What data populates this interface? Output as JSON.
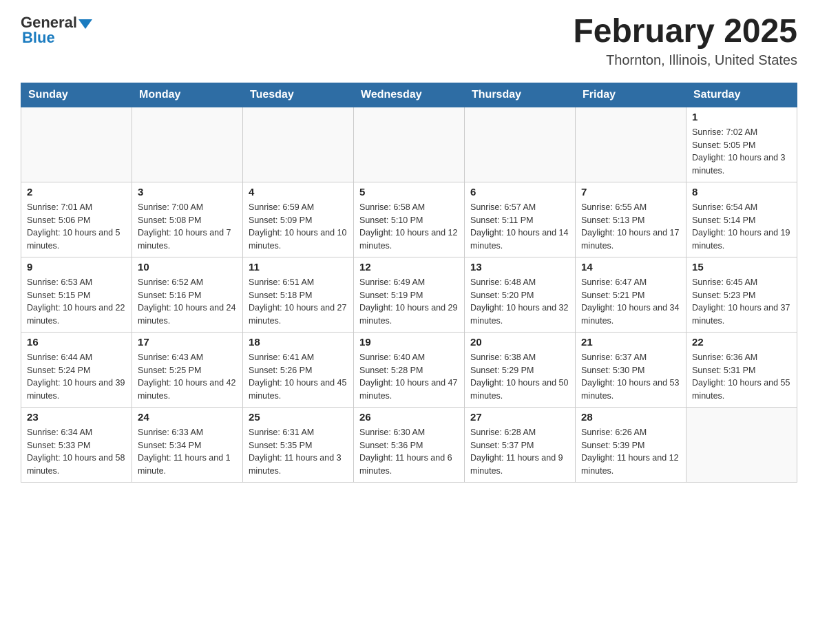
{
  "logo": {
    "general": "General",
    "blue": "Blue"
  },
  "header": {
    "month": "February 2025",
    "location": "Thornton, Illinois, United States"
  },
  "days_of_week": [
    "Sunday",
    "Monday",
    "Tuesday",
    "Wednesday",
    "Thursday",
    "Friday",
    "Saturday"
  ],
  "weeks": [
    [
      {
        "day": "",
        "info": ""
      },
      {
        "day": "",
        "info": ""
      },
      {
        "day": "",
        "info": ""
      },
      {
        "day": "",
        "info": ""
      },
      {
        "day": "",
        "info": ""
      },
      {
        "day": "",
        "info": ""
      },
      {
        "day": "1",
        "info": "Sunrise: 7:02 AM\nSunset: 5:05 PM\nDaylight: 10 hours and 3 minutes."
      }
    ],
    [
      {
        "day": "2",
        "info": "Sunrise: 7:01 AM\nSunset: 5:06 PM\nDaylight: 10 hours and 5 minutes."
      },
      {
        "day": "3",
        "info": "Sunrise: 7:00 AM\nSunset: 5:08 PM\nDaylight: 10 hours and 7 minutes."
      },
      {
        "day": "4",
        "info": "Sunrise: 6:59 AM\nSunset: 5:09 PM\nDaylight: 10 hours and 10 minutes."
      },
      {
        "day": "5",
        "info": "Sunrise: 6:58 AM\nSunset: 5:10 PM\nDaylight: 10 hours and 12 minutes."
      },
      {
        "day": "6",
        "info": "Sunrise: 6:57 AM\nSunset: 5:11 PM\nDaylight: 10 hours and 14 minutes."
      },
      {
        "day": "7",
        "info": "Sunrise: 6:55 AM\nSunset: 5:13 PM\nDaylight: 10 hours and 17 minutes."
      },
      {
        "day": "8",
        "info": "Sunrise: 6:54 AM\nSunset: 5:14 PM\nDaylight: 10 hours and 19 minutes."
      }
    ],
    [
      {
        "day": "9",
        "info": "Sunrise: 6:53 AM\nSunset: 5:15 PM\nDaylight: 10 hours and 22 minutes."
      },
      {
        "day": "10",
        "info": "Sunrise: 6:52 AM\nSunset: 5:16 PM\nDaylight: 10 hours and 24 minutes."
      },
      {
        "day": "11",
        "info": "Sunrise: 6:51 AM\nSunset: 5:18 PM\nDaylight: 10 hours and 27 minutes."
      },
      {
        "day": "12",
        "info": "Sunrise: 6:49 AM\nSunset: 5:19 PM\nDaylight: 10 hours and 29 minutes."
      },
      {
        "day": "13",
        "info": "Sunrise: 6:48 AM\nSunset: 5:20 PM\nDaylight: 10 hours and 32 minutes."
      },
      {
        "day": "14",
        "info": "Sunrise: 6:47 AM\nSunset: 5:21 PM\nDaylight: 10 hours and 34 minutes."
      },
      {
        "day": "15",
        "info": "Sunrise: 6:45 AM\nSunset: 5:23 PM\nDaylight: 10 hours and 37 minutes."
      }
    ],
    [
      {
        "day": "16",
        "info": "Sunrise: 6:44 AM\nSunset: 5:24 PM\nDaylight: 10 hours and 39 minutes."
      },
      {
        "day": "17",
        "info": "Sunrise: 6:43 AM\nSunset: 5:25 PM\nDaylight: 10 hours and 42 minutes."
      },
      {
        "day": "18",
        "info": "Sunrise: 6:41 AM\nSunset: 5:26 PM\nDaylight: 10 hours and 45 minutes."
      },
      {
        "day": "19",
        "info": "Sunrise: 6:40 AM\nSunset: 5:28 PM\nDaylight: 10 hours and 47 minutes."
      },
      {
        "day": "20",
        "info": "Sunrise: 6:38 AM\nSunset: 5:29 PM\nDaylight: 10 hours and 50 minutes."
      },
      {
        "day": "21",
        "info": "Sunrise: 6:37 AM\nSunset: 5:30 PM\nDaylight: 10 hours and 53 minutes."
      },
      {
        "day": "22",
        "info": "Sunrise: 6:36 AM\nSunset: 5:31 PM\nDaylight: 10 hours and 55 minutes."
      }
    ],
    [
      {
        "day": "23",
        "info": "Sunrise: 6:34 AM\nSunset: 5:33 PM\nDaylight: 10 hours and 58 minutes."
      },
      {
        "day": "24",
        "info": "Sunrise: 6:33 AM\nSunset: 5:34 PM\nDaylight: 11 hours and 1 minute."
      },
      {
        "day": "25",
        "info": "Sunrise: 6:31 AM\nSunset: 5:35 PM\nDaylight: 11 hours and 3 minutes."
      },
      {
        "day": "26",
        "info": "Sunrise: 6:30 AM\nSunset: 5:36 PM\nDaylight: 11 hours and 6 minutes."
      },
      {
        "day": "27",
        "info": "Sunrise: 6:28 AM\nSunset: 5:37 PM\nDaylight: 11 hours and 9 minutes."
      },
      {
        "day": "28",
        "info": "Sunrise: 6:26 AM\nSunset: 5:39 PM\nDaylight: 11 hours and 12 minutes."
      },
      {
        "day": "",
        "info": ""
      }
    ]
  ]
}
